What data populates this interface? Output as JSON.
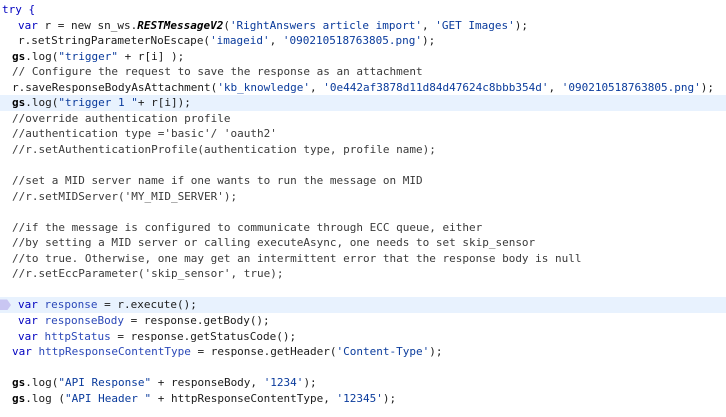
{
  "editor": {
    "lines": [
      {
        "indent": 0,
        "tokens": [
          {
            "t": "try {",
            "c": "kw"
          }
        ]
      },
      {
        "indent": 1,
        "tokens": [
          {
            "t": "var",
            "c": "kw"
          },
          {
            "t": " r = new sn_ws."
          },
          {
            "t": "RESTMessageV2",
            "c": "it"
          },
          {
            "t": "("
          },
          {
            "t": "'RightAnswers article import'",
            "c": "str"
          },
          {
            "t": ", "
          },
          {
            "t": "'GET Images'",
            "c": "str"
          },
          {
            "t": ");"
          }
        ]
      },
      {
        "indent": 1,
        "tokens": [
          {
            "t": "r.setStringParameterNoEscap",
            "c": "yellow"
          },
          {
            "t": "e("
          },
          {
            "t": "'imageid'",
            "c": "str"
          },
          {
            "t": ", "
          },
          {
            "t": "'090210518763805.png'",
            "c": "str"
          },
          {
            "t": ");"
          }
        ]
      },
      {
        "indent": 0,
        "tokens": [
          {
            "t": "gs",
            "c": "b"
          },
          {
            "t": ".log("
          },
          {
            "t": "\"trigger\"",
            "c": "str"
          },
          {
            "t": " + r[i] );"
          }
        ]
      },
      {
        "indent": 0,
        "tokens": [
          {
            "t": "// Configure the request to save the response as an attachment",
            "c": "cm"
          }
        ]
      },
      {
        "indent": 0,
        "tokens": [
          {
            "t": "r.saveResponseBodyAsAttachment("
          },
          {
            "t": "'kb_knowledge'",
            "c": "str"
          },
          {
            "t": ", "
          },
          {
            "t": "'0e442af3878d11d84d47624c8bbb354d'",
            "c": "str"
          },
          {
            "t": ", "
          },
          {
            "t": "'090210518763805.png'",
            "c": "str"
          },
          {
            "t": ");"
          }
        ]
      },
      {
        "indent": 0,
        "hl": true,
        "tokens": [
          {
            "t": "gs",
            "c": "b"
          },
          {
            "t": ".log("
          },
          {
            "t": "\"trigger 1 \"",
            "c": "str"
          },
          {
            "t": "+ r[i]);"
          }
        ]
      },
      {
        "indent": 0,
        "tokens": [
          {
            "t": "//override authentication profile",
            "c": "cm"
          }
        ]
      },
      {
        "indent": 0,
        "tokens": [
          {
            "t": "//authentication type ='basic'/ 'oauth2'",
            "c": "cm"
          }
        ]
      },
      {
        "indent": 0,
        "tokens": [
          {
            "t": "//r.setAuthenticationProfile(authentication type, profile name);",
            "c": "cm"
          }
        ]
      },
      {
        "indent": 0,
        "tokens": []
      },
      {
        "indent": 0,
        "tokens": [
          {
            "t": "//set a MID server name if one wants to run the message on MID",
            "c": "cm"
          }
        ]
      },
      {
        "indent": 0,
        "tokens": [
          {
            "t": "//r.setMIDServer('MY_MID_SERVER');",
            "c": "cm"
          }
        ]
      },
      {
        "indent": 0,
        "tokens": []
      },
      {
        "indent": 0,
        "tokens": [
          {
            "t": "//if the message is configured to communicate through ECC queue, either",
            "c": "cm"
          }
        ]
      },
      {
        "indent": 0,
        "tokens": [
          {
            "t": "//by setting a MID server or calling executeAsync, one needs to set skip_sensor",
            "c": "cm"
          }
        ]
      },
      {
        "indent": 0,
        "tokens": [
          {
            "t": "//to true. Otherwise, one may get an intermittent error that the response body is null",
            "c": "cm"
          }
        ]
      },
      {
        "indent": 0,
        "tokens": [
          {
            "t": "//r.setEccParameter('skip_sensor', true);",
            "c": "cm"
          }
        ]
      },
      {
        "indent": 0,
        "tokens": []
      },
      {
        "indent": 1,
        "hl": true,
        "marker": true,
        "tokens": [
          {
            "t": "var",
            "c": "kw"
          },
          {
            "t": " "
          },
          {
            "t": "response",
            "c": "var"
          },
          {
            "t": " = r.execute();"
          }
        ]
      },
      {
        "indent": 1,
        "tokens": [
          {
            "t": "var",
            "c": "kw"
          },
          {
            "t": " "
          },
          {
            "t": "responseBody",
            "c": "var"
          },
          {
            "t": " = response.getBody();"
          }
        ]
      },
      {
        "indent": 1,
        "tokens": [
          {
            "t": "var",
            "c": "kw"
          },
          {
            "t": " "
          },
          {
            "t": "httpStatus",
            "c": "var"
          },
          {
            "t": " = response.getStatusCode();"
          }
        ]
      },
      {
        "indent": 0,
        "tokens": [
          {
            "t": "var",
            "c": "kw"
          },
          {
            "t": " "
          },
          {
            "t": "httpResponseContentType",
            "c": "var"
          },
          {
            "t": " = response.getHeader("
          },
          {
            "t": "'Content-Type'",
            "c": "str"
          },
          {
            "t": ");"
          }
        ]
      },
      {
        "indent": 0,
        "tokens": []
      },
      {
        "indent": 0,
        "tokens": [
          {
            "t": "gs",
            "c": "b"
          },
          {
            "t": ".log("
          },
          {
            "t": "\"API Response\"",
            "c": "str"
          },
          {
            "t": " + responseBody, "
          },
          {
            "t": "'1234'",
            "c": "str"
          },
          {
            "t": ");"
          }
        ]
      },
      {
        "indent": 0,
        "tokens": [
          {
            "t": "gs",
            "c": "b"
          },
          {
            "t": ".log ("
          },
          {
            "t": "\"API Header \"",
            "c": "str"
          },
          {
            "t": " + httpResponseContentType, "
          },
          {
            "t": "'12345'",
            "c": "str"
          },
          {
            "t": ");"
          }
        ]
      }
    ]
  }
}
